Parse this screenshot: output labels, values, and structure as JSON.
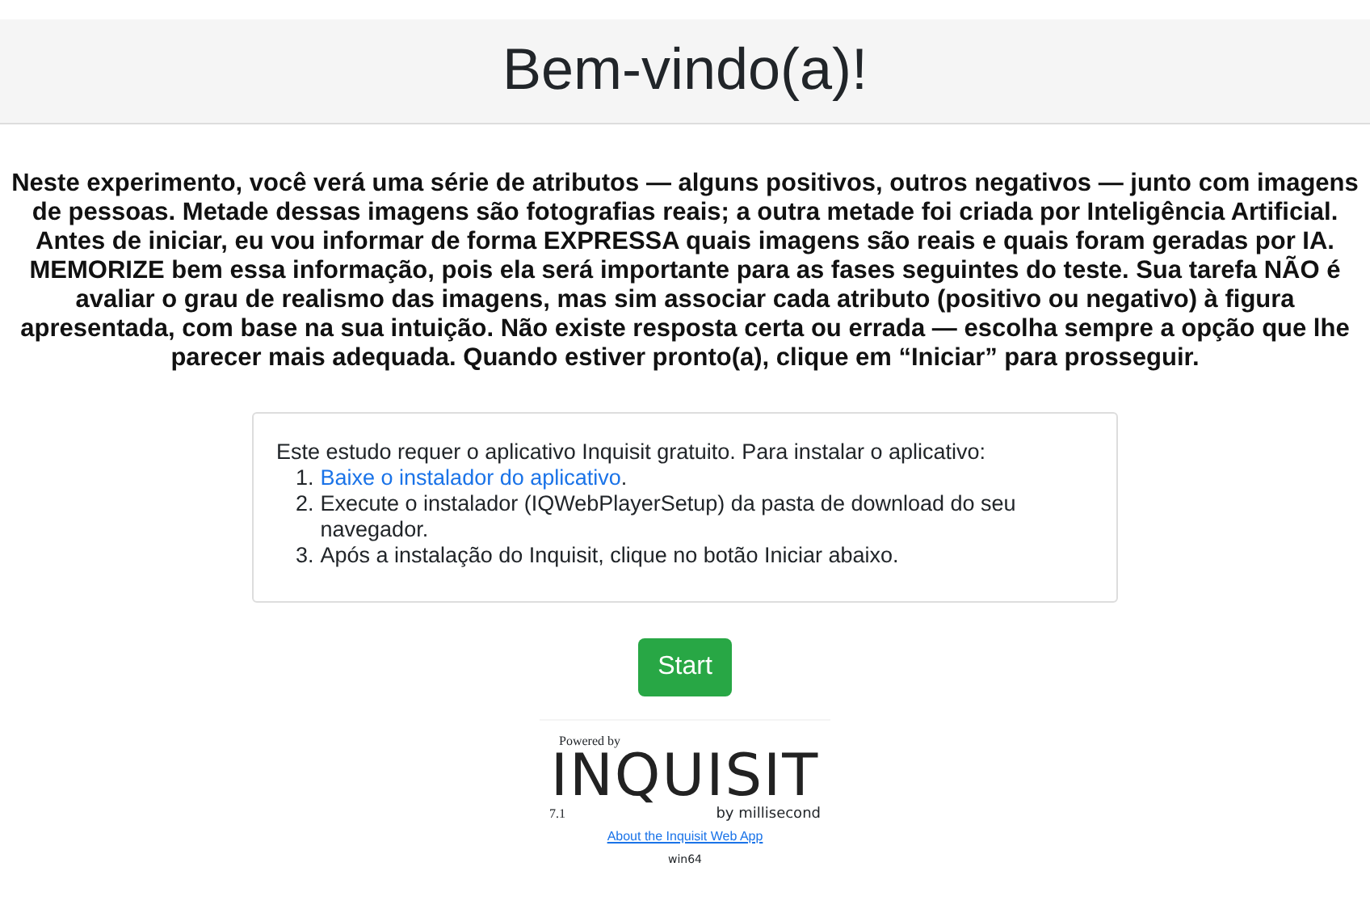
{
  "header": {
    "title": "Bem-vindo(a)!"
  },
  "intro": "Neste experimento, você verá uma série de atributos — alguns positivos, outros negativos — junto com imagens de pessoas. Metade dessas imagens são fotografias reais; a outra metade foi criada por Inteligência Artificial. Antes de iniciar, eu vou informar de forma EXPRESSA quais imagens são reais e quais foram geradas por IA. MEMORIZE bem essa informação, pois ela será importante para as fases seguintes do teste. Sua tarefa NÃO é avaliar o grau de realismo das imagens, mas sim associar cada atributo (positivo ou negativo) à figura apresentada, com base na sua intuição. Não existe resposta certa ou errada — escolha sempre a opção que lhe parecer mais adequada. Quando estiver pronto(a), clique em “Iniciar” para prosseguir.",
  "install_box": {
    "lead": "Este estudo requer o aplicativo Inquisit gratuito. Para instalar o aplicativo:",
    "steps": [
      {
        "number": "1.",
        "kind": "link",
        "text": "Baixe o instalador do aplicativo",
        "after": "."
      },
      {
        "number": "2.",
        "kind": "text",
        "text": "Execute o instalador (IQWebPlayerSetup) da pasta de download do seu navegador."
      },
      {
        "number": "3.",
        "kind": "text",
        "text": "Após a instalação do Inquisit, clique no botão Iniciar abaixo."
      }
    ]
  },
  "start_button": "Start",
  "footer": {
    "powered_by": "Powered by",
    "logo": "INQUISIT",
    "version": "7.1",
    "tagline": "by millisecond",
    "about_link": "About the Inquisit Web App",
    "platform": "win64"
  }
}
